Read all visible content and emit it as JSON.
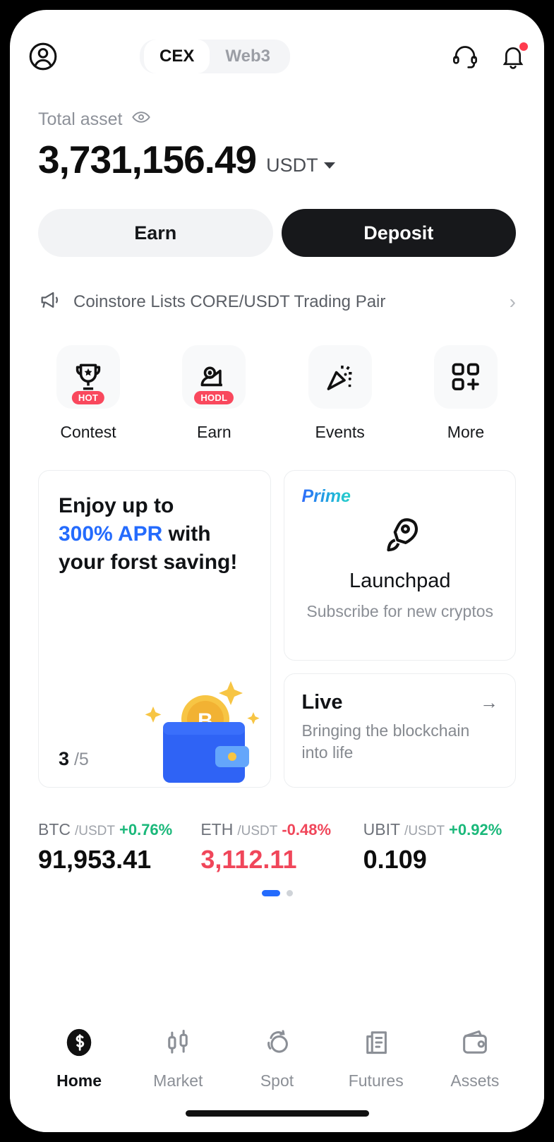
{
  "header": {
    "avatar_icon": "user-circle-icon",
    "tabs": [
      {
        "label": "CEX",
        "active": true
      },
      {
        "label": "Web3",
        "active": false
      }
    ],
    "support_icon": "headset-icon",
    "notification_icon": "bell-icon",
    "notification_badge": true
  },
  "balance": {
    "label": "Total asset",
    "eye_icon": "eye-icon",
    "amount": "3,731,156.49",
    "currency": "USDT"
  },
  "actions": {
    "earn_label": "Earn",
    "deposit_label": "Deposit"
  },
  "announcement": {
    "icon": "megaphone-icon",
    "text": "Coinstore Lists CORE/USDT Trading Pair",
    "chevron": "›"
  },
  "quick_actions": [
    {
      "label": "Contest",
      "icon": "trophy-icon",
      "badge": "HOT"
    },
    {
      "label": "Earn",
      "icon": "piggy-bank-icon",
      "badge": "HODL"
    },
    {
      "label": "Events",
      "icon": "confetti-icon",
      "badge": ""
    },
    {
      "label": "More",
      "icon": "grid-plus-icon",
      "badge": ""
    }
  ],
  "promo": {
    "line1": "Enjoy up to",
    "accent": "300% APR",
    "line2_rest": " with",
    "line3": "your forst saving!",
    "page_current": "3",
    "page_total": "/5",
    "art_icon": "wallet-bitcoin-illustration"
  },
  "launchpad": {
    "tag": "Prime",
    "icon": "rocket-icon",
    "title": "Launchpad",
    "subtitle": "Subscribe for new cryptos"
  },
  "live": {
    "title": "Live",
    "arrow": "→",
    "subtitle": "Bringing the blockchain into life"
  },
  "tickers": [
    {
      "base": "BTC",
      "quote": "/USDT",
      "change": "+0.76%",
      "direction": "up",
      "price": "91,953.41"
    },
    {
      "base": "ETH",
      "quote": "/USDT",
      "change": "-0.48%",
      "direction": "down",
      "price": "3,112.11"
    },
    {
      "base": "UBIT",
      "quote": "/USDT",
      "change": "+0.92%",
      "direction": "up",
      "price": "0.109"
    }
  ],
  "ticker_pages": {
    "current": 1,
    "total": 2
  },
  "nav": [
    {
      "label": "Home",
      "icon": "home-logo-icon",
      "active": true
    },
    {
      "label": "Market",
      "icon": "candlestick-icon",
      "active": false
    },
    {
      "label": "Spot",
      "icon": "swap-circles-icon",
      "active": false
    },
    {
      "label": "Futures",
      "icon": "document-icon",
      "active": false
    },
    {
      "label": "Assets",
      "icon": "wallet-icon",
      "active": false
    }
  ],
  "colors": {
    "accent_blue": "#246bfd",
    "up_green": "#1ab87a",
    "down_red": "#f0465a",
    "badge_red": "#f9485d",
    "dark": "#17181b"
  }
}
